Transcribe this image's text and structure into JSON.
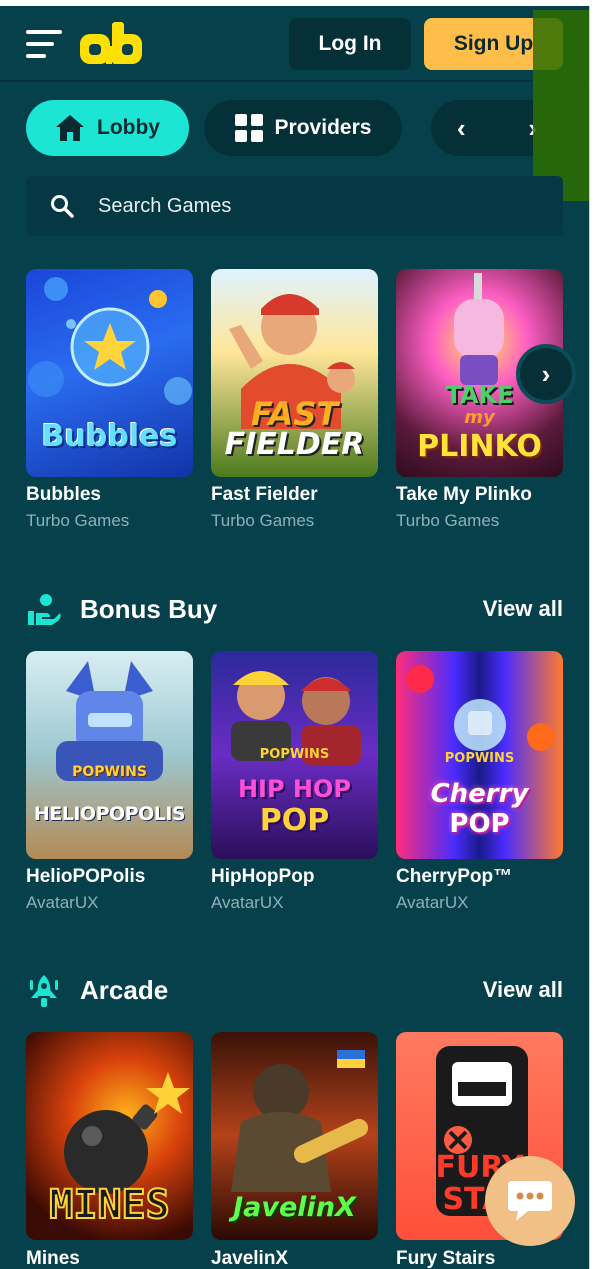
{
  "header": {
    "logo_text": "ab",
    "login_label": "Log In",
    "signup_label": "Sign Up"
  },
  "nav": {
    "lobby_label": "Lobby",
    "providers_label": "Providers",
    "prev_arrow": "‹",
    "next_arrow": "›"
  },
  "search": {
    "placeholder": "Search Games"
  },
  "featured": [
    {
      "name": "Bubbles",
      "provider": "Turbo Games",
      "cover": "Bubbles"
    },
    {
      "name": "Fast Fielder",
      "provider": "Turbo Games",
      "cover_line1": "FAST",
      "cover_line2": "FIELDER"
    },
    {
      "name": "Take My Plinko",
      "provider": "Turbo Games",
      "cover_line1": "TAKE",
      "cover_line2": "my",
      "cover_line3": "PLINKO"
    }
  ],
  "carousel_next": "›",
  "bonus_buy": {
    "title": "Bonus Buy",
    "view_all": "View all",
    "games": [
      {
        "name": "HelioPOPolis",
        "provider": "AvatarUX",
        "badge": "POPWINS",
        "cover": "HELIOPOPOLIS"
      },
      {
        "name": "HipHopPop",
        "provider": "AvatarUX",
        "badge": "POPWINS",
        "cover_line1": "HIP HOP",
        "cover_line2": "POP"
      },
      {
        "name": "CherryPop™",
        "provider": "AvatarUX",
        "badge": "POPWINS",
        "cover_line1": "Cherry",
        "cover_line2": "POP"
      }
    ]
  },
  "arcade": {
    "title": "Arcade",
    "view_all": "View all",
    "games": [
      {
        "name": "Mines",
        "cover": "MINES"
      },
      {
        "name": "JavelinX",
        "cover": "JavelinX"
      },
      {
        "name": "Fury Stairs",
        "cover_line1": "FURY",
        "cover_line2": "STAI"
      }
    ]
  },
  "colors": {
    "background": "#06414b",
    "accent_cyan": "#1ce5d4",
    "signup_orange": "#ffbd4a",
    "dark_pill": "#053038"
  }
}
